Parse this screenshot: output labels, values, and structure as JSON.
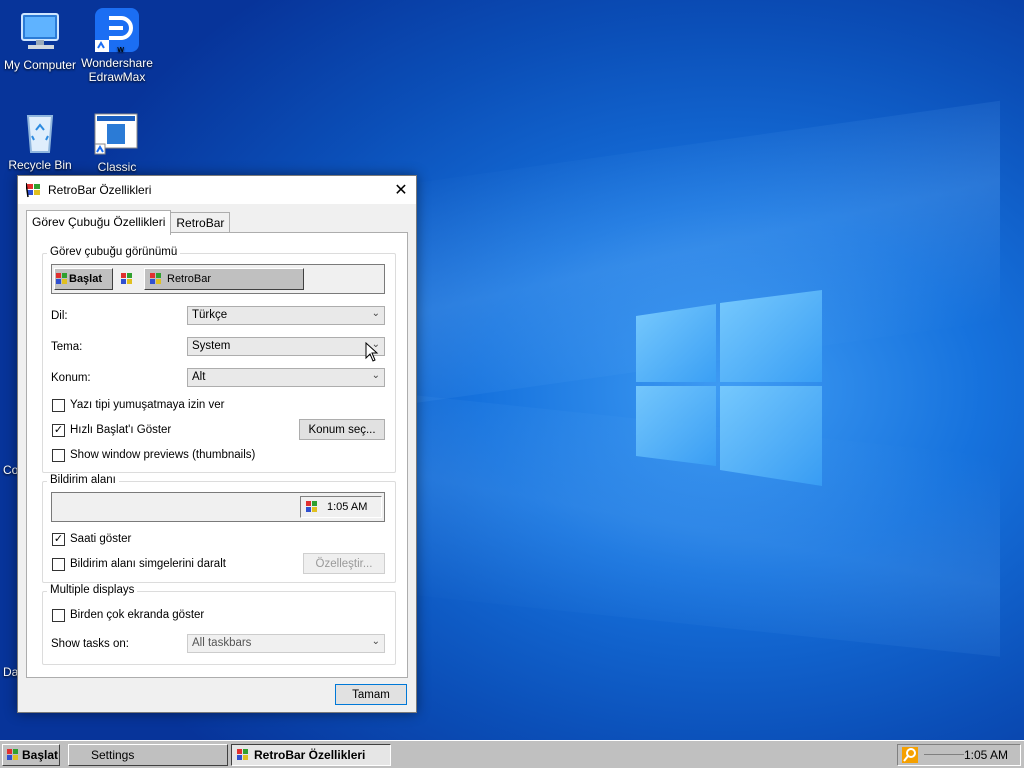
{
  "desktop": {
    "icons": [
      {
        "label": "My Computer"
      },
      {
        "label": "Wondershare EdrawMax"
      },
      {
        "label": "Recycle Bin"
      },
      {
        "label": "Classic"
      }
    ],
    "partial_labels": [
      "Co",
      "Da"
    ]
  },
  "dialog": {
    "title": "RetroBar Özellikleri",
    "close_glyph": "✕",
    "tabs": [
      {
        "label": "Görev Çubuğu Özellikleri",
        "active": true
      },
      {
        "label": "RetroBar",
        "active": false
      }
    ],
    "taskbar_group": {
      "legend": "Görev çubuğu görünümü",
      "preview_start": "Başlat",
      "preview_window": "RetroBar",
      "language_label": "Dil:",
      "language_value": "Türkçe",
      "theme_label": "Tema:",
      "theme_value": "System",
      "position_label": "Konum:",
      "position_value": "Alt",
      "font_smoothing_label": "Yazı tipi yumuşatmaya izin ver",
      "font_smoothing_checked": false,
      "quick_launch_label": "Hızlı Başlat'ı Göster",
      "quick_launch_checked": true,
      "choose_location_button": "Konum seç...",
      "thumbnails_label": "Show window previews (thumbnails)",
      "thumbnails_checked": false
    },
    "notification_group": {
      "legend": "Bildirim alanı",
      "preview_clock": "1:05 AM",
      "show_clock_label": "Saati göster",
      "show_clock_checked": true,
      "collapse_icons_label": "Bildirim alanı simgelerini daralt",
      "collapse_icons_checked": false,
      "customize_button": "Özelleştir..."
    },
    "multi_display_group": {
      "legend": "Multiple displays",
      "show_all_label": "Birden çok ekranda göster",
      "show_all_checked": false,
      "show_tasks_label": "Show tasks on:",
      "show_tasks_value": "All taskbars"
    },
    "ok_button": "Tamam"
  },
  "taskbar": {
    "start_label": "Başlat",
    "tasks": [
      {
        "label": "Settings",
        "active": false
      },
      {
        "label": "RetroBar Özellikleri",
        "active": true
      }
    ],
    "clock": "1:05 AM"
  },
  "colors": {
    "desktop_blue": "#1672dd",
    "retro_gray": "#c0c0c0",
    "accent": "#0078d7"
  }
}
